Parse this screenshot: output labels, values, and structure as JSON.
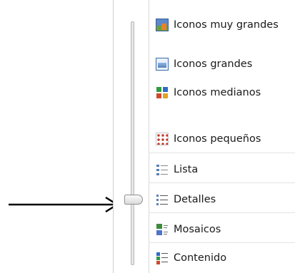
{
  "view_menu": {
    "items": [
      {
        "label": "Iconos muy grandes",
        "icon": "extra-large-icons-icon"
      },
      {
        "label": "Iconos grandes",
        "icon": "large-icons-icon"
      },
      {
        "label": "Iconos medianos",
        "icon": "medium-icons-icon"
      },
      {
        "label": "Iconos pequeños",
        "icon": "small-icons-icon"
      },
      {
        "label": "Lista",
        "icon": "list-view-icon"
      },
      {
        "label": "Detalles",
        "icon": "details-view-icon"
      },
      {
        "label": "Mosaicos",
        "icon": "tiles-view-icon"
      },
      {
        "label": "Contenido",
        "icon": "content-view-icon"
      }
    ],
    "selected": "Detalles"
  },
  "annotation": {
    "icon": "right-arrow-icon",
    "color": "#000000"
  }
}
